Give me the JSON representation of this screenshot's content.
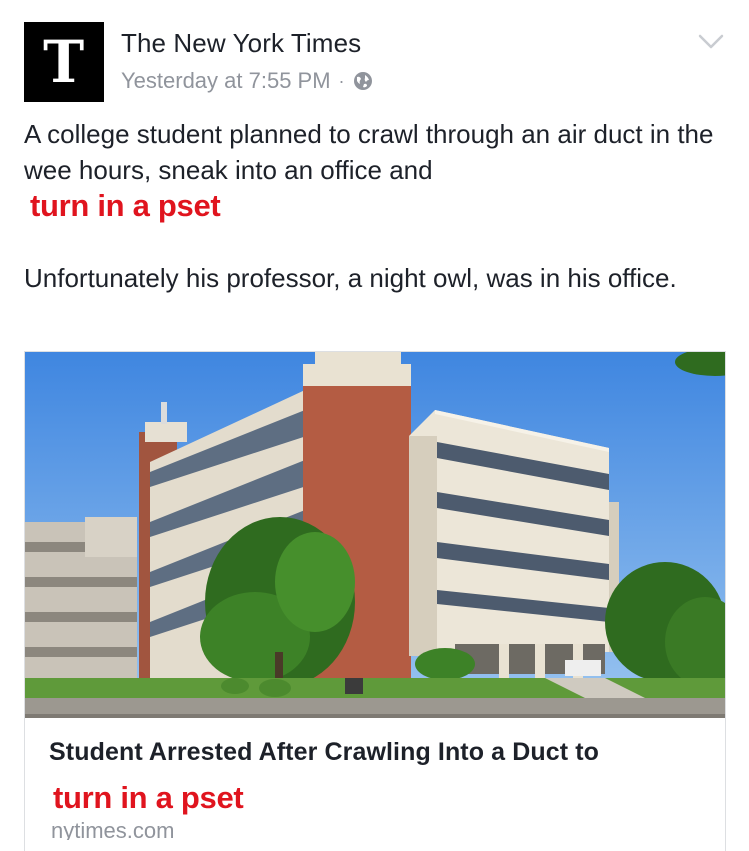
{
  "post": {
    "page_name": "The New York Times",
    "timestamp": "Yesterday at 7:55 PM",
    "separator": "·",
    "privacy_icon": "globe-icon",
    "menu_icon": "chevron-down-icon",
    "avatar_glyph": "T",
    "text_line_1": "A college student planned to crawl through an air duct in the wee hours, sneak into an office and",
    "overlay_text_1": "turn in a pset",
    "text_para_2": "Unfortunately his professor, a night owl, was in his office."
  },
  "link_card": {
    "image_icon": "building-photo",
    "title": "Student Arrested After Crawling Into a Duct to",
    "overlay_text": "turn in a pset",
    "domain": "nytimes.com"
  },
  "colors": {
    "overlay_red": "#e0141e",
    "secondary_text": "#90949c",
    "primary_text": "#1d2129",
    "avatar_bg": "#000000"
  }
}
